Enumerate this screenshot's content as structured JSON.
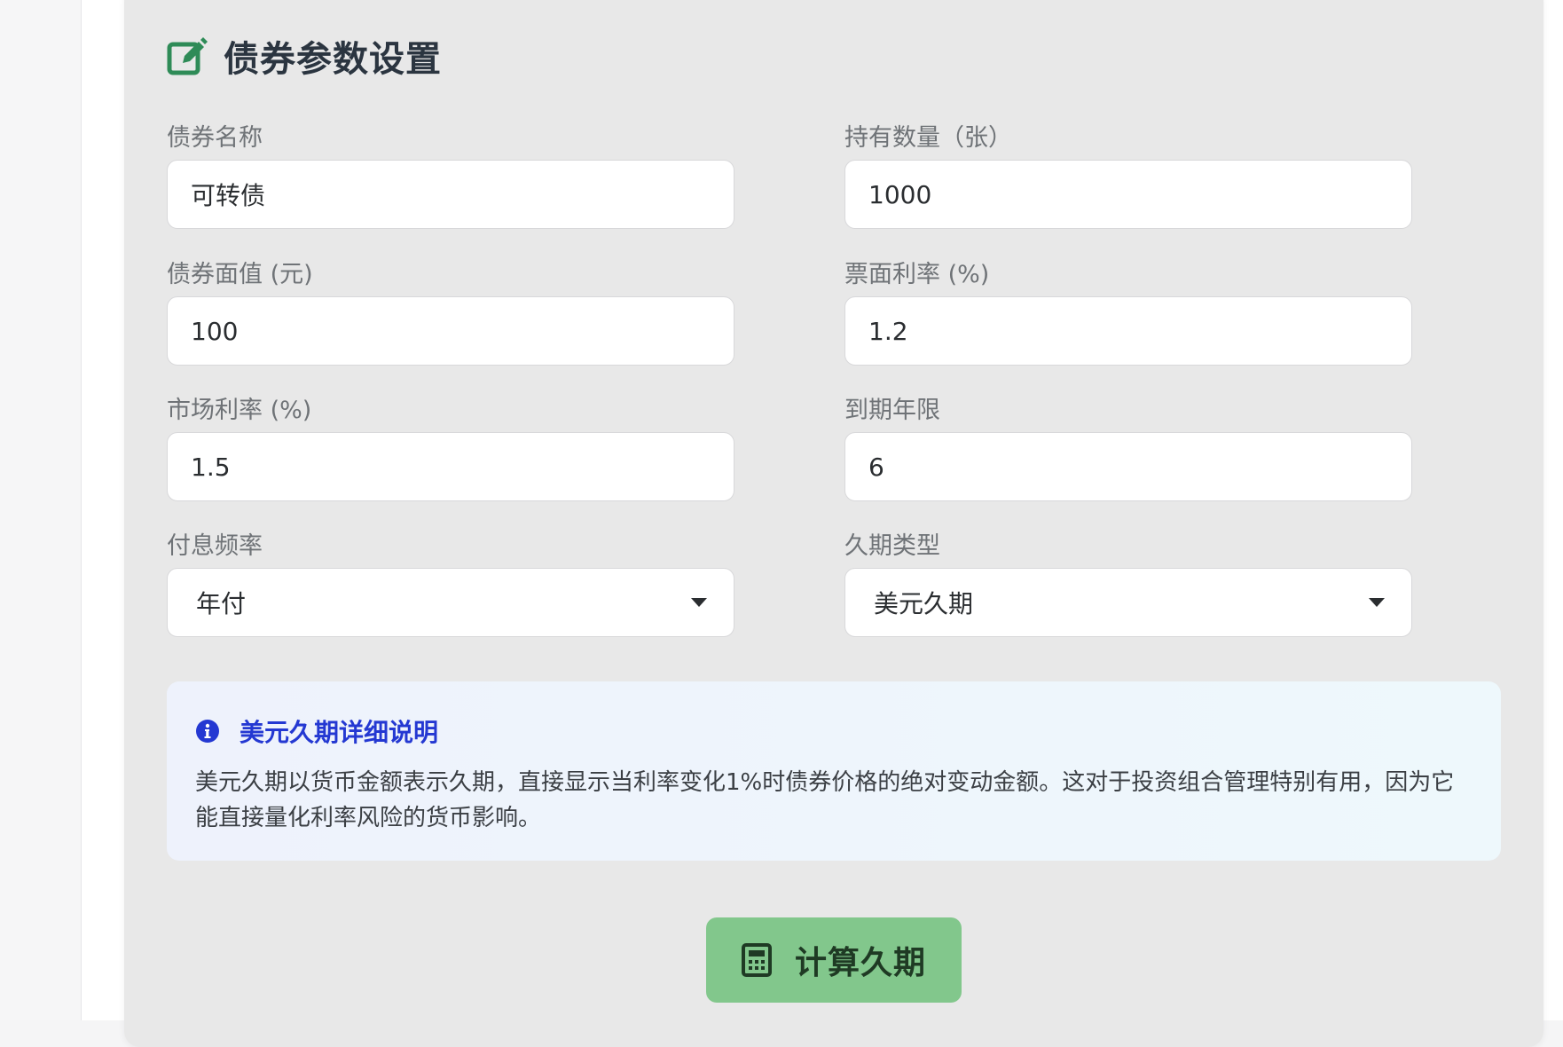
{
  "panel": {
    "title": "债券参数设置",
    "title_icon": "edit-icon",
    "accent_color": "#2e8b57"
  },
  "fields": {
    "bond_name": {
      "label": "债券名称",
      "value": "可转债"
    },
    "quantity": {
      "label": "持有数量（张）",
      "value": "1000"
    },
    "face_value": {
      "label": "债券面值 (元)",
      "value": "100"
    },
    "coupon_rate": {
      "label": "票面利率 (%)",
      "value": "1.2"
    },
    "market_rate": {
      "label": "市场利率 (%)",
      "value": "1.5"
    },
    "maturity": {
      "label": "到期年限",
      "value": "6"
    },
    "payment_frequency": {
      "label": "付息频率",
      "selected": "年付"
    },
    "duration_type": {
      "label": "久期类型",
      "selected": "美元久期"
    }
  },
  "info": {
    "icon": "info-icon",
    "title": "美元久期详细说明",
    "body": "美元久期以货币金额表示久期，直接显示当利率变化1%时债券价格的绝对变动金额。这对于投资组合管理特别有用，因为它能直接量化利率风险的货币影响。",
    "title_color": "#2438d2"
  },
  "action": {
    "label": "计算久期",
    "icon": "calculator-icon",
    "color": "#82c78c"
  }
}
